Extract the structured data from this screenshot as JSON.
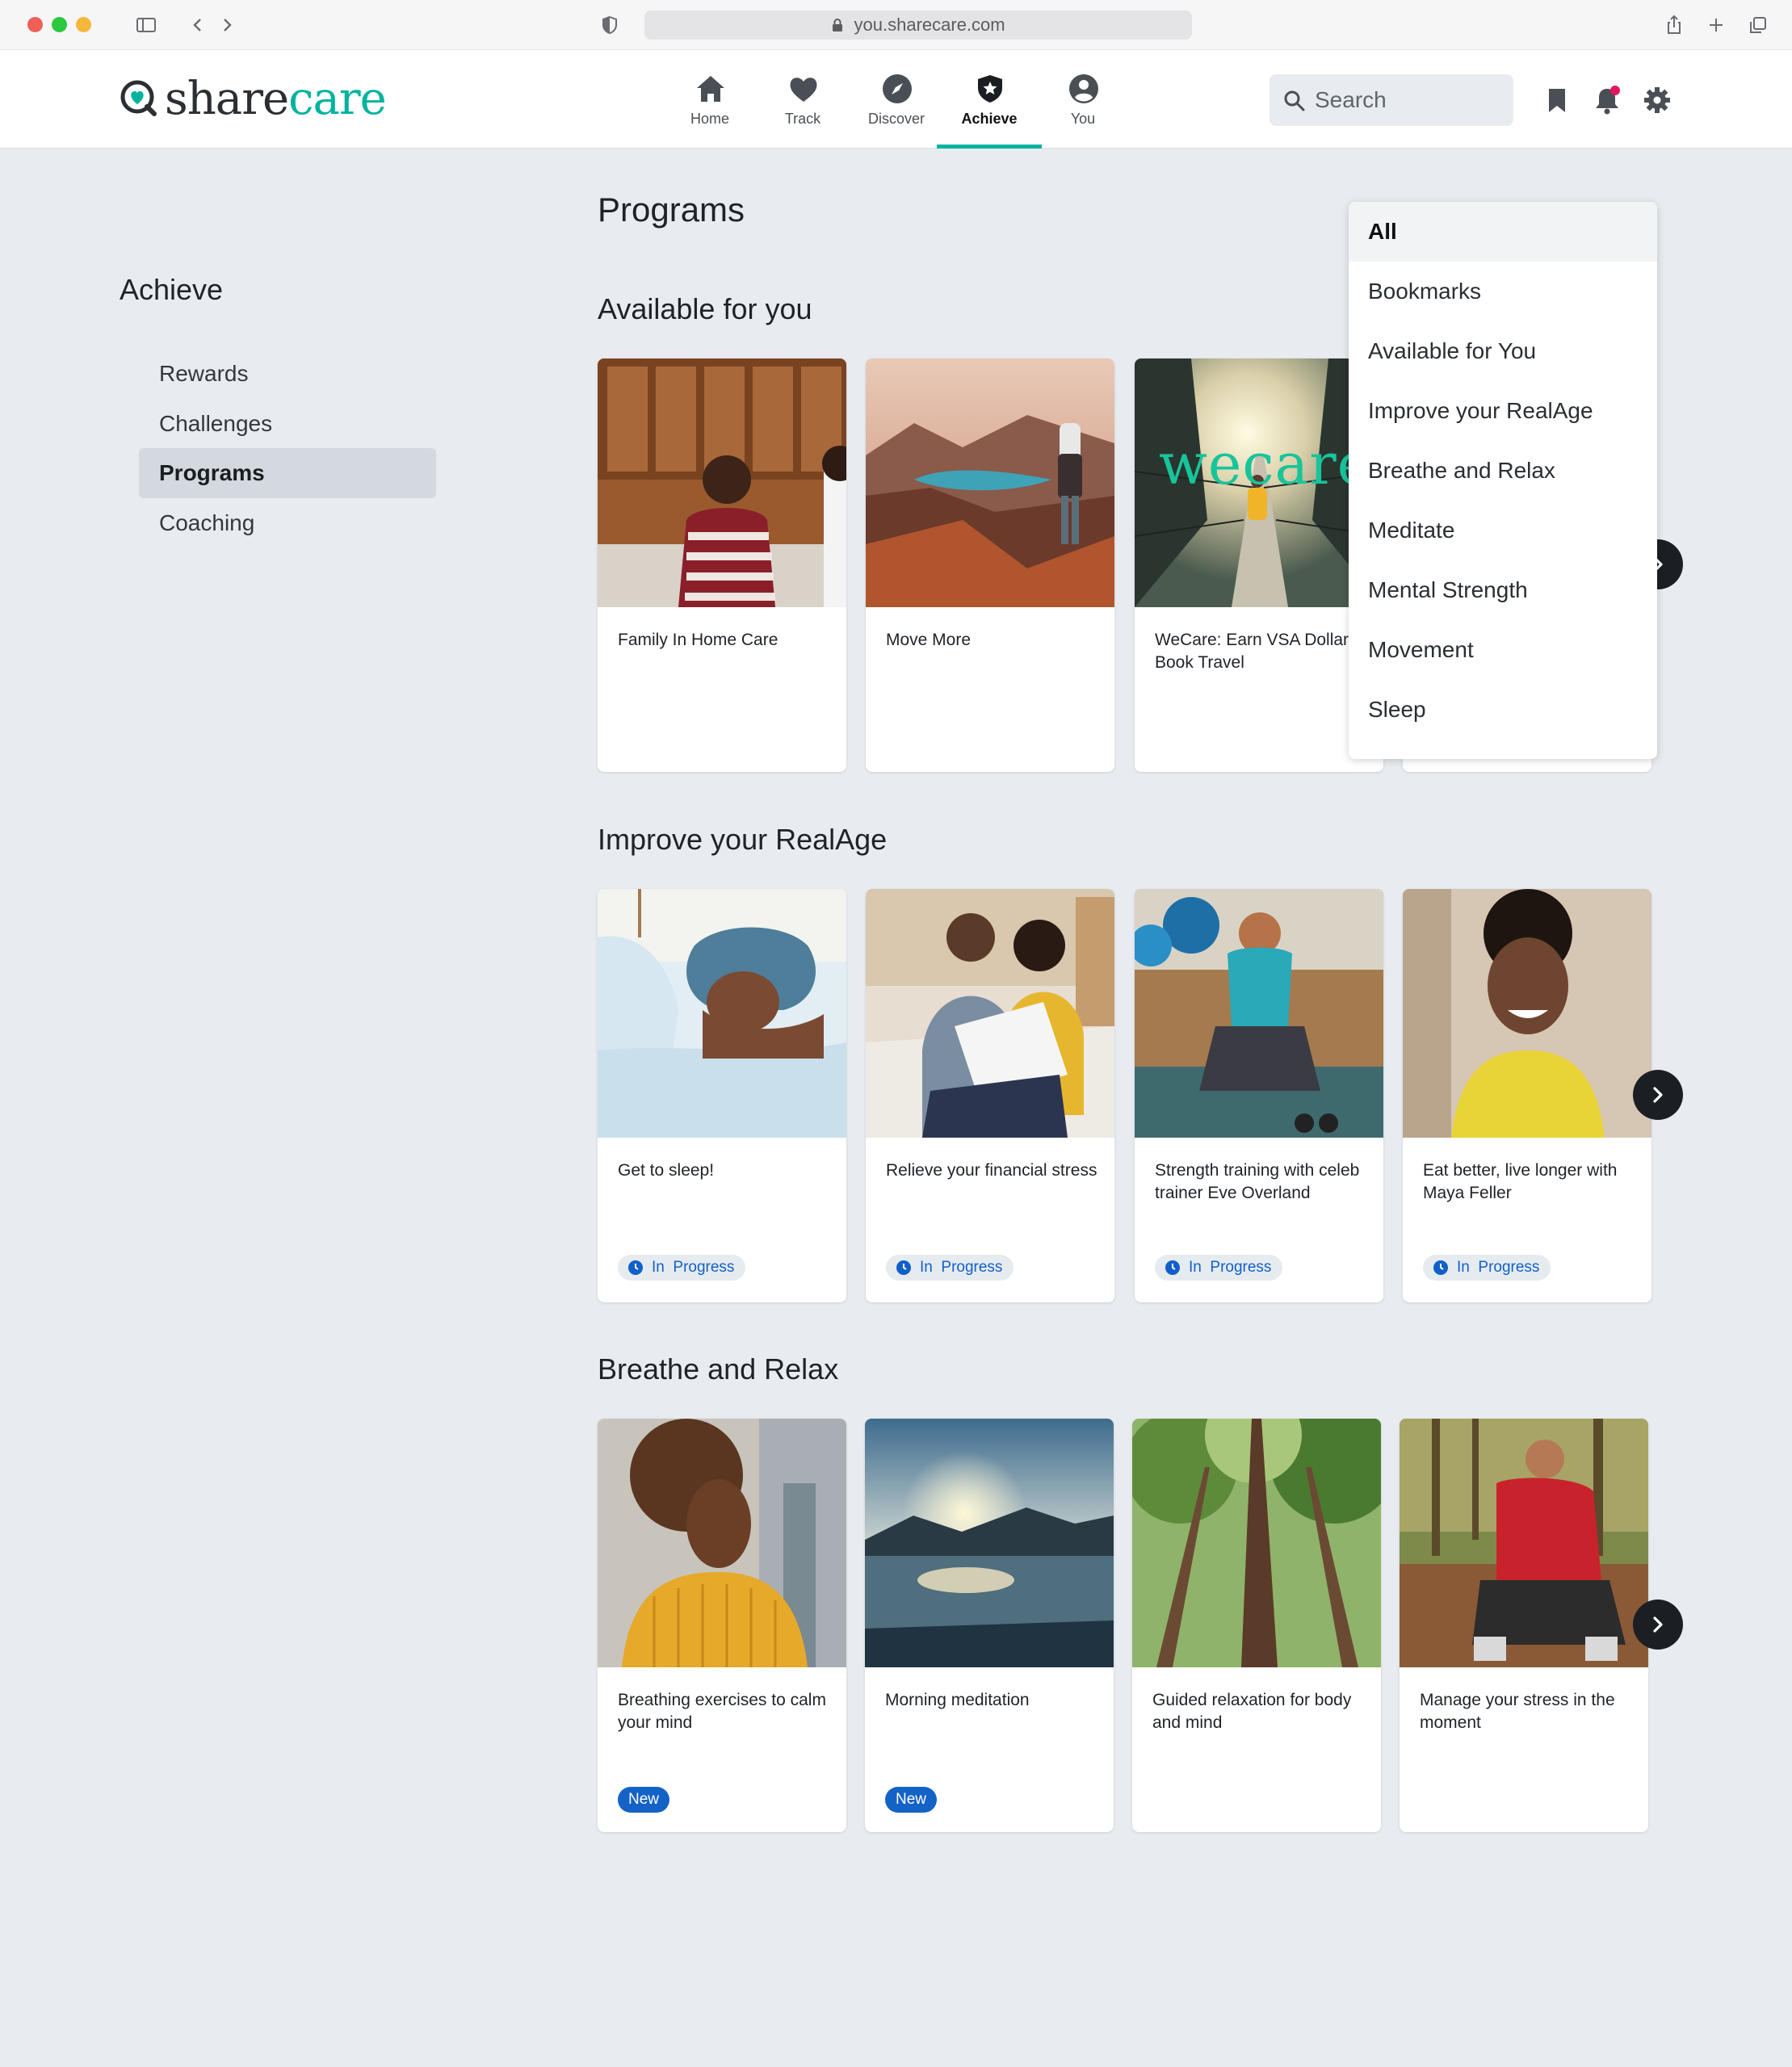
{
  "browser": {
    "url": "you.sharecare.com"
  },
  "brand": {
    "name_part1": "share",
    "name_part2": "care",
    "accent_color": "#00b39e"
  },
  "nav": {
    "items": [
      {
        "label": "Home",
        "icon": "home-icon"
      },
      {
        "label": "Track",
        "icon": "heart-icon"
      },
      {
        "label": "Discover",
        "icon": "compass-icon"
      },
      {
        "label": "Achieve",
        "icon": "shield-star-icon",
        "active": true
      },
      {
        "label": "You",
        "icon": "user-icon"
      }
    ]
  },
  "search": {
    "placeholder": "Search"
  },
  "sidebar": {
    "title": "Achieve",
    "items": [
      {
        "label": "Rewards"
      },
      {
        "label": "Challenges"
      },
      {
        "label": "Programs",
        "active": true
      },
      {
        "label": "Coaching"
      }
    ]
  },
  "main": {
    "title": "Programs",
    "sections": [
      {
        "title": "Available for you",
        "cards": [
          {
            "title": "Family In Home Care"
          },
          {
            "title": "Move More"
          },
          {
            "title": "WeCare: Earn VSA Dollars - Book Travel",
            "image_text": "wecare"
          }
        ]
      },
      {
        "title": "Improve your RealAge",
        "cards": [
          {
            "title": "Get to sleep!",
            "badge": "In  Progress"
          },
          {
            "title": "Relieve your financial stress",
            "badge": "In  Progress"
          },
          {
            "title": "Strength training with celeb trainer Eve Overland",
            "badge": "In  Progress"
          },
          {
            "title": "Eat better, live longer with Maya Feller",
            "badge": "In  Progress"
          }
        ]
      },
      {
        "title": "Breathe and Relax",
        "cards": [
          {
            "title": "Breathing exercises to calm your mind",
            "badge": "New"
          },
          {
            "title": "Morning meditation",
            "badge": "New"
          },
          {
            "title": "Guided relaxation for body and mind"
          },
          {
            "title": "Manage your stress in the moment"
          }
        ]
      }
    ]
  },
  "dropdown": {
    "selected": "All",
    "options": [
      "All",
      "Bookmarks",
      "Available for You",
      "Improve your RealAge",
      "Breathe and Relax",
      "Meditate",
      "Mental Strength",
      "Movement",
      "Sleep"
    ]
  }
}
